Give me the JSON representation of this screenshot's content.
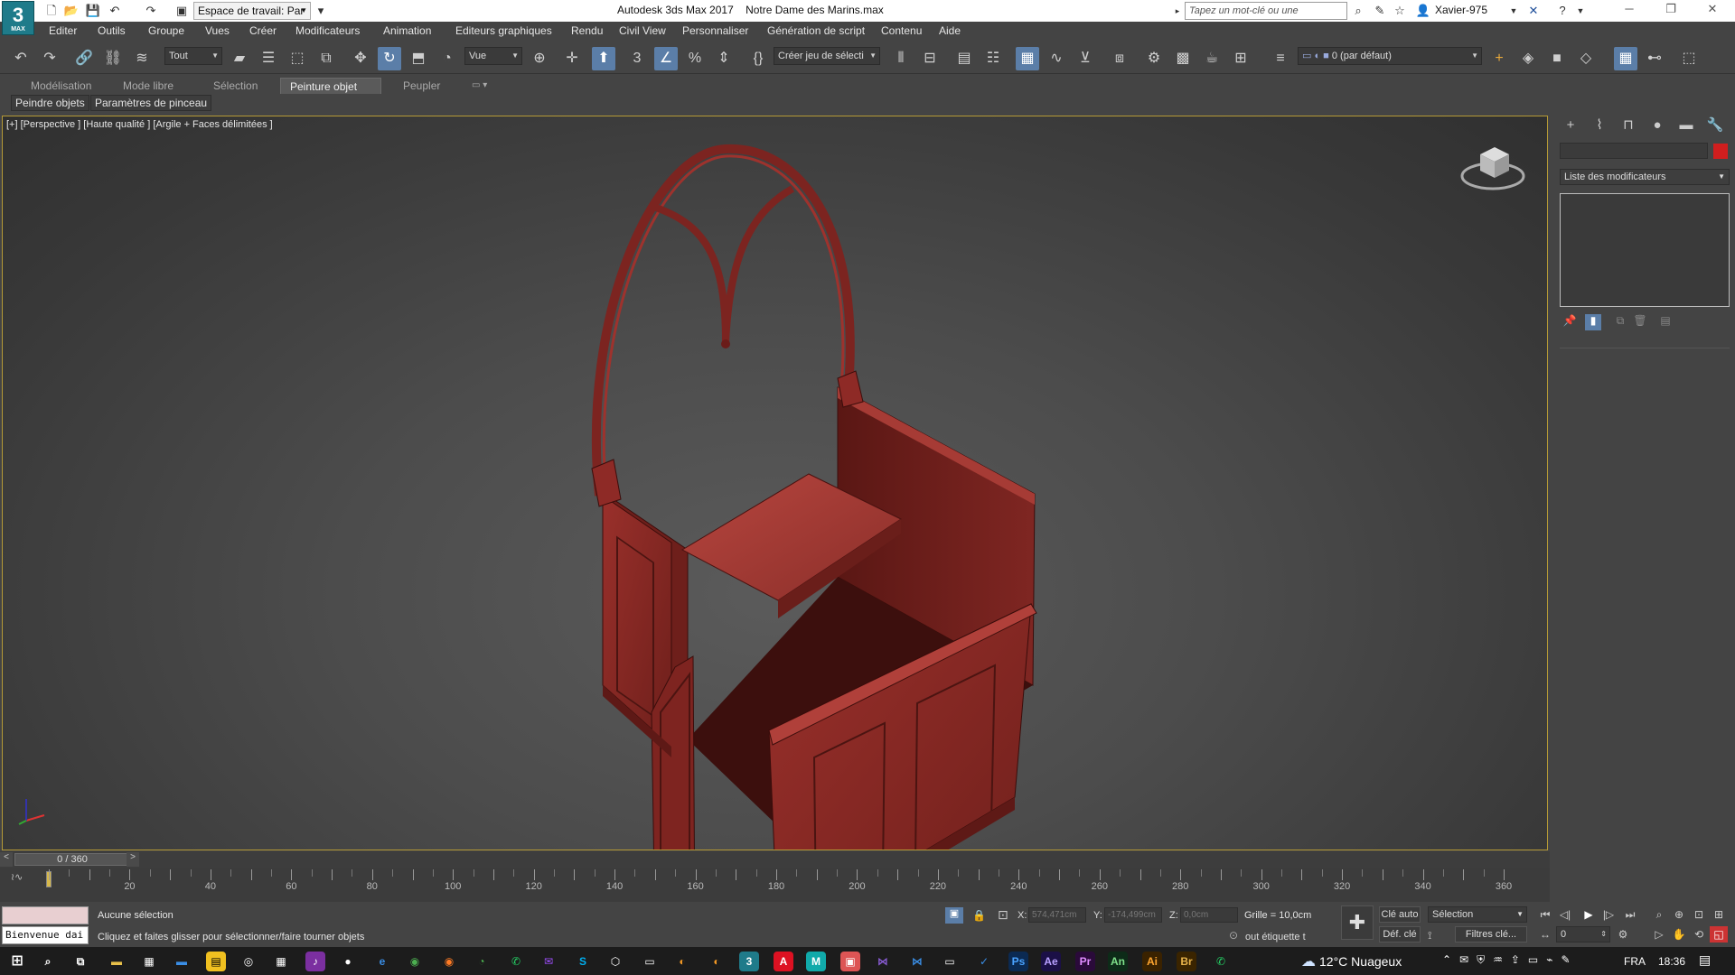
{
  "app": {
    "logo_text": "3",
    "logo_sub": "MAX",
    "window_title": "Autodesk 3ds Max 2017    Notre Dame des Marins.max",
    "workspace": "Espace de travail: Par",
    "search_placeholder": "Tapez un mot-clé ou une expression",
    "user": "Xavier-975"
  },
  "menu": [
    "Editer",
    "Outils",
    "Groupe",
    "Vues",
    "Créer",
    "Modificateurs",
    "Animation",
    "Editeurs graphiques",
    "Rendu",
    "Civil View",
    "Personnaliser",
    "Génération de script",
    "Contenu",
    "Aide"
  ],
  "toolbar": {
    "selection_filter": "Tout",
    "ref_coord": "Vue",
    "named_selection": "Créer jeu de sélecti",
    "layer": "0 (par défaut)"
  },
  "ribbon": {
    "tabs": [
      "Modélisation",
      "Mode libre",
      "Sélection",
      "Peinture objet",
      "Peupler"
    ],
    "active_tab": "Peinture objet",
    "sub_buttons": [
      "Peindre objets",
      "Paramètres de pinceau"
    ]
  },
  "viewport": {
    "label": "[+] [Perspective ] [Haute qualité ] [Argile + Faces délimitées ]",
    "model_color": "#8e2a26"
  },
  "command_panel": {
    "modifier_list": "Liste des modificateurs",
    "object_color": "#d01e1e"
  },
  "time": {
    "frame_label": "0 / 360",
    "ticks": [
      20,
      40,
      60,
      80,
      100,
      120,
      140,
      160,
      180,
      200,
      220,
      240,
      260,
      280,
      300,
      320,
      340,
      360
    ]
  },
  "status": {
    "maxscript_text": "Bienvenue dai",
    "selection": "Aucune sélection",
    "prompt": "Cliquez et faites glisser pour sélectionner/faire tourner objets",
    "x_label": "X:",
    "x_value": "574,471cm",
    "y_label": "Y:",
    "y_value": "-174,499cm",
    "z_label": "Z:",
    "z_value": "0,0cm",
    "grid": "Grille = 10,0cm",
    "add_time_tag": "out étiquette t",
    "auto_key": "Clé auto",
    "set_key": "Déf. clé",
    "key_mode": "Sélection",
    "key_filters": "Filtres clé...",
    "current_frame": "0"
  },
  "taskbar": {
    "weather": "12°C  Nuageux",
    "lang": "FRA",
    "time": "18:36"
  }
}
